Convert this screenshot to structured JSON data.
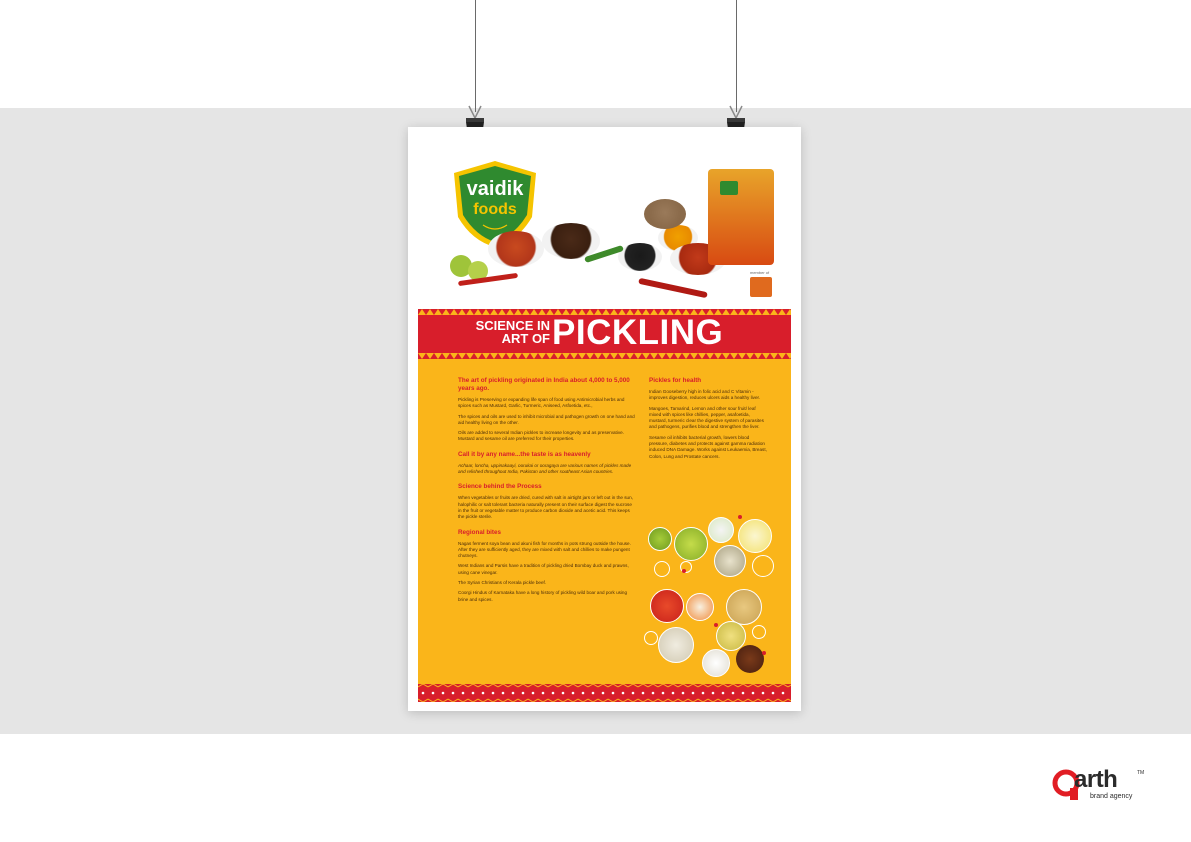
{
  "logo": {
    "line1": "vaidik",
    "line2": "foods"
  },
  "member_label": "member of",
  "headline": {
    "small_line1": "SCIENCE IN",
    "small_line2": "ART OF",
    "big": "PICKLING"
  },
  "left_column": [
    {
      "heading": "The art of pickling originated in India about 4,000 to 5,000 years ago.",
      "paragraphs": [
        "Pickling is Preserving or expanding life span of food using Antimicrobial herbs and spices such as Mustard, Garlic, Turmeric, Aniseed, Asfoetida, etc.,",
        "The spices and oils are used to inhibit microbial and pathogen growth on one hand and aid healthy living on the other.",
        "Oils are added to several Indian pickles to increase longevity and as preservative. Mustard and sesame oil are preferred for their properties."
      ]
    },
    {
      "heading": "Call it by any name...the taste is as heavenly",
      "paragraphs": [
        "Achaar, loncha, uppinakaayi, oorukai or ooragaya are various names of pickles made and relished throughout India, Pakistan and other southeast Asian countries."
      ]
    },
    {
      "heading": "Science behind the Process",
      "paragraphs": [
        "When vegetables or fruits are dried, cured with salt in airtight jars or left out in the sun, halophilic or salt tolerant bacteria naturally present on their surface digest the sucrose in the fruit or vegetable matter to produce carbon dioxide and acetic acid. This keeps the pickle sterile."
      ]
    },
    {
      "heading": "Regional bites",
      "paragraphs": [
        "Nagas ferment soya bean and akuni fish for months in pots strung outside the house. After they are sufficiently aged, they are mixed with salt and chillies to make pungent chutneys.",
        "West Indians and Parsis have a tradition of pickling dried Bombay duck and prawns, using cane vinegar.",
        "The Syrian Christians of Kerala pickle beef.",
        "Coorgi Hindus of Karnataka have a long history of pickling wild boar and pork using brine and spices."
      ]
    }
  ],
  "right_column": [
    {
      "heading": "Pickles for health",
      "paragraphs": [
        "Indian Gooseberry high in folic acid and C Vitamin - improves digestion, reduces ulcers aids a healthy liver.",
        "Mangoes, Tamarind, Lemon and other sour fruit/ leaf mixed with spices like chillies, pepper, asafoetida, mustard, turmeric clear the digestive system of parasites and pathogens, purifies blood and strengthen the liver.",
        "Sesame oil inhibits bacterial growth, lowers blood pressure, diabetes and protects against gamma radiation induced DNA Damage. Works against Leukaemia, Breast, Colon, Lung and Prostate cancers."
      ]
    }
  ],
  "agency": {
    "name": "arth",
    "tagline": "brand agency",
    "tm": "TM"
  },
  "colors": {
    "red": "#d81e2b",
    "yellow": "#fab51a",
    "green": "#2f8a2f",
    "band": "#e5e5e5"
  },
  "icons": [
    "binder-clip-icon",
    "spice-bowl-icon",
    "ingredient-circle-icon",
    "arth-logo-icon"
  ]
}
